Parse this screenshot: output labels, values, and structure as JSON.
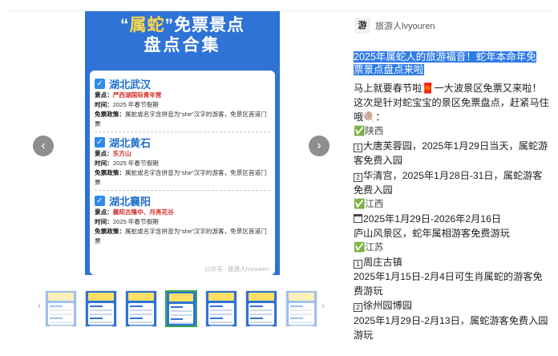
{
  "viewer": {
    "prev_icon": "chevron-left-icon",
    "next_icon": "chevron-right-icon",
    "poster": {
      "title_quote_open": "“",
      "title_highlight": "属蛇",
      "title_quote_close": "”",
      "title_rest": "免票景点",
      "subtitle": "盘点合集",
      "sections": [
        {
          "city": "湖北武汉",
          "spot_label": "景点：",
          "spot_value": "严西湖国际青年营",
          "time_label": "时间：",
          "time_value": "2025 年春节假期",
          "policy_label": "免票政策：",
          "policy_value": "属蛇或名字含拼音为“she”汉字的游客，免景区首道门票"
        },
        {
          "city": "湖北黄石",
          "spot_label": "景点：",
          "spot_value": "东方山",
          "time_label": "时间：",
          "time_value": "2025 年春节假期",
          "policy_label": "免票政策：",
          "policy_value": "属蛇或名字含拼音为“she”汉字的游客，免景区首道门票"
        },
        {
          "city": "湖北襄阳",
          "spot_label": "景点：",
          "spot_value": "襄阳古隆中、月亮花谷",
          "time_label": "时间：",
          "time_value": "2025 年春节假期",
          "policy_label": "免票政策：",
          "policy_value": "属蛇或名字含拼音为“she”汉字的游客，免景区首道门票"
        }
      ],
      "watermark": "公众号 · 旅游人lvyouren"
    },
    "thumbnails": {
      "count_visible": 7,
      "active_index": 3
    }
  },
  "author": {
    "avatar_text": "游",
    "name": "旅游人lvyouren"
  },
  "post": {
    "title": "2025年属蛇人的旅游福音！蛇年本命年免票景点盘点来啦",
    "body": {
      "intro": "马上就要春节啦🧧一大波景区免票又来啦！这次是针对蛇宝宝的景区免票盘点，赶紧马住哦🍭：",
      "province1": "✅陕西",
      "item1_num": "1",
      "item1": "大唐芙蓉园，2025年1月29日当天，属蛇游客免费入园",
      "item2_num": "2",
      "item2": "华清宫，2025年1月28日-31日，属蛇游客免费入园",
      "province2": "✅江西",
      "item3_date": "2025年1月29日-2026年2月16日",
      "item3": "庐山风景区，蛇年属相游客免费游玩",
      "province3": "✅江苏",
      "item4_num": "1",
      "item4_name": "周庄古镇",
      "item4": "2025年1月15日-2月4日可生肖属蛇的游客免费游玩",
      "item5_num": "2",
      "item5_name": "徐州园博园",
      "item5": "2025年1月29日-2月13日，属蛇游客免费入园游玩"
    }
  },
  "colors": {
    "poster_blue": "#2f73d6",
    "title_yellow": "#ffd84a",
    "highlight_blue": "#2f7be6",
    "active_thumb": "#35a853"
  }
}
